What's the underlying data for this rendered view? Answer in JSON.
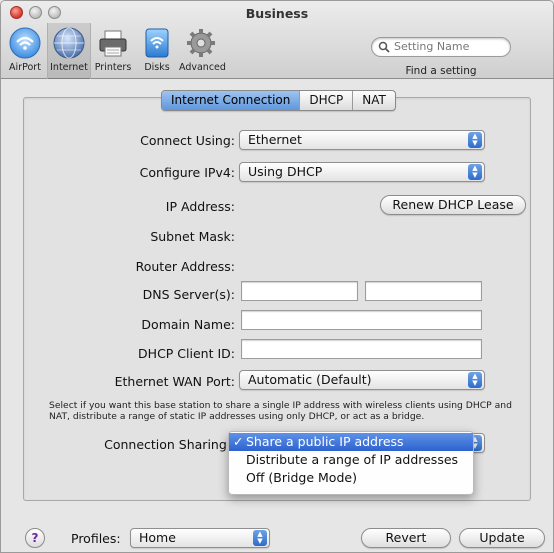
{
  "window": {
    "title": "Business"
  },
  "toolbar": {
    "items": [
      {
        "label": "AirPort",
        "icon": "airport-icon"
      },
      {
        "label": "Internet",
        "icon": "globe-icon"
      },
      {
        "label": "Printers",
        "icon": "printer-icon"
      },
      {
        "label": "Disks",
        "icon": "disk-icon"
      },
      {
        "label": "Advanced",
        "icon": "gear-icon"
      }
    ],
    "selected": "Internet",
    "search": {
      "placeholder": "Setting Name",
      "caption": "Find a setting"
    }
  },
  "tabs": {
    "items": [
      "Internet Connection",
      "DHCP",
      "NAT"
    ],
    "active": "Internet Connection"
  },
  "form": {
    "connect_using": {
      "label": "Connect Using:",
      "value": "Ethernet"
    },
    "configure_ipv4": {
      "label": "Configure IPv4:",
      "value": "Using DHCP"
    },
    "ip_address": {
      "label": "IP Address:"
    },
    "renew_button": "Renew DHCP Lease",
    "subnet_mask": {
      "label": "Subnet Mask:"
    },
    "router_address": {
      "label": "Router Address:"
    },
    "dns_servers": {
      "label": "DNS Server(s):",
      "value1": "",
      "value2": ""
    },
    "domain_name": {
      "label": "Domain Name:",
      "value": ""
    },
    "dhcp_client_id": {
      "label": "DHCP Client ID:",
      "value": ""
    },
    "ethernet_wan_port": {
      "label": "Ethernet WAN Port:",
      "value": "Automatic (Default)"
    },
    "help_text": "Select if you want this base station to share a single IP address with wireless clients using DHCP and NAT, distribute a range of static IP addresses using only DHCP, or act as a bridge.",
    "connection_sharing": {
      "label": "Connection Sharing:",
      "options": [
        "Share a public IP address",
        "Distribute a range of IP addresses",
        "Off (Bridge Mode)"
      ],
      "selected": "Share a public IP address",
      "check_glyph": "✓"
    }
  },
  "bottom": {
    "help": "?",
    "profiles_label": "Profiles:",
    "profile_value": "Home",
    "revert": "Revert",
    "update": "Update"
  },
  "colors": {
    "accent": "#3d74d6",
    "close": "#d5372b"
  }
}
